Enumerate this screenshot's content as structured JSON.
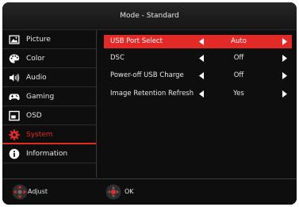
{
  "header": {
    "title": "Mode - Standard"
  },
  "sidebar": {
    "items": [
      {
        "label": "Picture",
        "icon": "picture-icon",
        "active": false
      },
      {
        "label": "Color",
        "icon": "palette-icon",
        "active": false
      },
      {
        "label": "Audio",
        "icon": "speaker-icon",
        "active": false
      },
      {
        "label": "Gaming",
        "icon": "gamepad-icon",
        "active": false
      },
      {
        "label": "OSD",
        "icon": "osd-window-icon",
        "active": false
      },
      {
        "label": "System",
        "icon": "gear-icon",
        "active": true
      },
      {
        "label": "Information",
        "icon": "info-icon",
        "active": false
      }
    ]
  },
  "settings": {
    "rows": [
      {
        "label": "USB Port Select",
        "value": "Auto",
        "selected": true
      },
      {
        "label": "DSC",
        "value": "Off",
        "selected": false
      },
      {
        "label": "Power-off USB Charge",
        "value": "Off",
        "selected": false
      },
      {
        "label": "Image Retention Refresh",
        "value": "Yes",
        "selected": false
      }
    ]
  },
  "footer": {
    "adjust_label": "Adjust",
    "ok_label": "OK"
  },
  "colors": {
    "accent": "#e32a26",
    "background": "#0e0e0e",
    "text": "#e8e8e8"
  }
}
